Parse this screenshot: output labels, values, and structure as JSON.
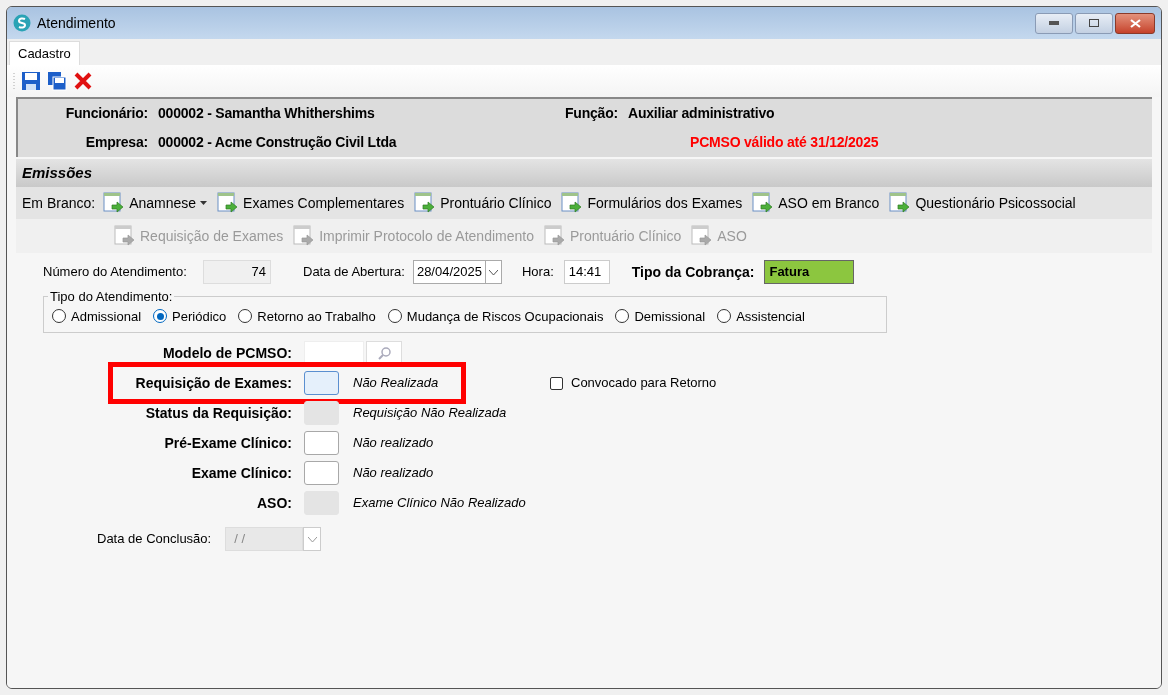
{
  "window": {
    "title": "Atendimento"
  },
  "tabs": [
    {
      "label": "Cadastro",
      "selected": true
    }
  ],
  "header": {
    "employee_label": "Funcionário:",
    "employee": "000002 - Samantha Whithershims",
    "role_label": "Função:",
    "role": "Auxiliar administrativo",
    "company_label": "Empresa:",
    "company": "000002 - Acme Construção Civil Ltda",
    "pcmso_notice": "PCMSO válido até 31/12/2025"
  },
  "emissions": {
    "title": "Emissões",
    "blank_label": "Em Branco:",
    "row_1": [
      {
        "label": "Anamnese",
        "disabled": false,
        "dropdown": true
      },
      {
        "label": "Exames Complementares",
        "disabled": false,
        "dropdown": false
      },
      {
        "label": "Prontuário Clínico",
        "disabled": false,
        "dropdown": false
      },
      {
        "label": "Formulários dos Exames",
        "disabled": false,
        "dropdown": false
      },
      {
        "label": "ASO em Branco",
        "disabled": false,
        "dropdown": false
      },
      {
        "label": "Questionário Psicossocial",
        "disabled": false,
        "dropdown": false
      }
    ],
    "row_2": [
      {
        "label": "Requisição de Exames",
        "disabled": true,
        "dropdown": false
      },
      {
        "label": "Imprimir Protocolo de Atendimento",
        "disabled": true,
        "dropdown": false
      },
      {
        "label": "Prontuário Clínico",
        "disabled": true,
        "dropdown": false
      },
      {
        "label": "ASO",
        "disabled": true,
        "dropdown": false
      }
    ]
  },
  "fields": {
    "number_label": "Número do Atendimento:",
    "number": "74",
    "opening_label": "Data de Abertura:",
    "opening_date": "28/04/2025",
    "time_label": "Hora:",
    "time": "14:41",
    "billing_label": "Tipo da Cobrança:",
    "billing": "Fatura"
  },
  "attendance_type": {
    "title": "Tipo do Atendimento:",
    "options": [
      {
        "label": "Admissional",
        "selected": false
      },
      {
        "label": "Periódico",
        "selected": true
      },
      {
        "label": "Retorno ao Trabalho",
        "selected": false
      },
      {
        "label": "Mudança de Riscos Ocupacionais",
        "selected": false
      },
      {
        "label": "Demissional",
        "selected": false
      },
      {
        "label": "Assistencial",
        "selected": false
      }
    ]
  },
  "pcmso_model": {
    "label": "Modelo de PCMSO:"
  },
  "status_rows": [
    {
      "label": "Requisição de Exames:",
      "status": "Não Realizada",
      "focused": true,
      "disabled": false,
      "highlighted": true
    },
    {
      "label": "Status da Requisição:",
      "status": "Requisição Não Realizada",
      "focused": false,
      "disabled": true,
      "highlighted": false
    },
    {
      "label": "Pré-Exame Clínico:",
      "status": "Não realizado",
      "focused": false,
      "disabled": false,
      "highlighted": false
    },
    {
      "label": "Exame Clínico:",
      "status": "Não realizado",
      "focused": false,
      "disabled": false,
      "highlighted": false
    },
    {
      "label": "ASO:",
      "status": "Exame Clínico Não Realizado",
      "focused": false,
      "disabled": true,
      "highlighted": false
    }
  ],
  "recall": {
    "label": "Convocado para Retorno",
    "checked": false
  },
  "conclusion": {
    "label": "Data de Conclusão:",
    "value": "/ /"
  }
}
